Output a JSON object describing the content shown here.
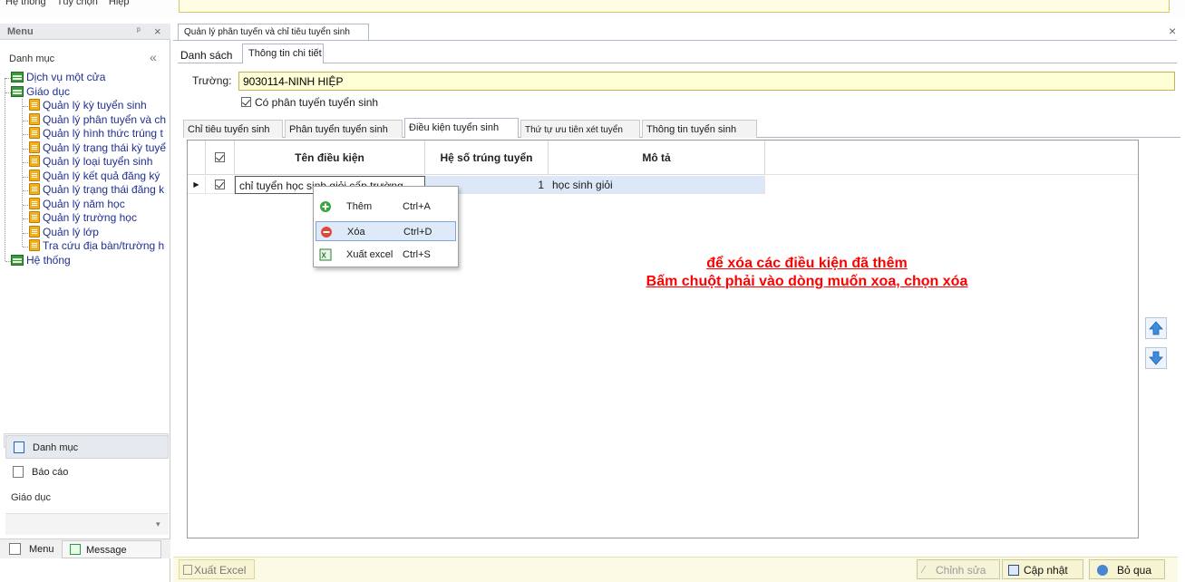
{
  "top_menu": [
    "Hệ thống",
    "Tùy chọn",
    "Hiệp"
  ],
  "left_panel": {
    "title": "Menu",
    "pin_glyph": "ᵖ",
    "section_title": "Danh mục",
    "tree": [
      {
        "label": "Dịch vụ một cửa",
        "level": 0,
        "icon": "folder-icon"
      },
      {
        "label": "Giáo dục",
        "level": 0,
        "icon": "folder-icon"
      },
      {
        "label": "Quản lý kỳ tuyển sinh",
        "level": 1,
        "icon": "doc-icon"
      },
      {
        "label": "Quản lý phân tuyển và ch",
        "level": 1,
        "icon": "doc-icon"
      },
      {
        "label": "Quản lý hình thức trúng t",
        "level": 1,
        "icon": "doc-icon"
      },
      {
        "label": "Quản lý trạng thái kỳ tuyể",
        "level": 1,
        "icon": "doc-icon"
      },
      {
        "label": "Quản lý loại tuyển sinh",
        "level": 1,
        "icon": "doc-icon"
      },
      {
        "label": "Quản lý kết quả đăng ký",
        "level": 1,
        "icon": "doc-icon"
      },
      {
        "label": "Quản lý trạng thái đăng k",
        "level": 1,
        "icon": "doc-icon"
      },
      {
        "label": "Quản lý năm học",
        "level": 1,
        "icon": "doc-icon"
      },
      {
        "label": "Quản lý trường học",
        "level": 1,
        "icon": "doc-icon"
      },
      {
        "label": "Quản lý lớp",
        "level": 1,
        "icon": "doc-icon"
      },
      {
        "label": "Tra cứu địa bàn/trường h",
        "level": 1,
        "icon": "doc-icon"
      },
      {
        "label": "Hệ thống",
        "level": 0,
        "icon": "folder-icon"
      }
    ],
    "nav": [
      {
        "label": "Danh mục",
        "active": true
      },
      {
        "label": "Báo cáo",
        "active": false
      }
    ],
    "group_label": "Giáo dục",
    "bottom_tabs": [
      "Menu",
      "Message"
    ]
  },
  "document": {
    "tab_title": "Quản lý phân tuyến và chỉ tiêu tuyển sinh",
    "sub_tabs": [
      "Danh sách",
      "Thông tin chi tiết"
    ],
    "truong_label": "Trường:",
    "truong_value": "9030114-NINH HIỆP",
    "checkbox_label": "Có phân tuyến tuyển sinh",
    "checkbox_checked": true,
    "inner_tabs": [
      "Chỉ tiêu tuyển sinh",
      "Phân tuyển tuyển sinh",
      "Điều kiện tuyển sinh",
      "Thứ tự ưu tiên xét tuyển",
      "Thông tin tuyển sinh"
    ],
    "active_inner_tab": 2
  },
  "grid": {
    "columns": [
      "Tên điều kiện",
      "Hệ số trúng tuyển",
      "Mô tả"
    ],
    "rows": [
      {
        "name": "chỉ tuyển học sinh giỏi cấp trường",
        "heso": "1",
        "mota": "học sinh giỏi",
        "checked": true
      }
    ]
  },
  "context_menu": [
    {
      "label": "Thêm",
      "shortcut": "Ctrl+A",
      "icon": "add-icon",
      "highlighted": false
    },
    {
      "label": "Xóa",
      "shortcut": "Ctrl+D",
      "icon": "delete-icon",
      "highlighted": true
    },
    {
      "label": "Xuất excel",
      "shortcut": "Ctrl+S",
      "icon": "excel-icon",
      "highlighted": false
    }
  ],
  "annotation": {
    "line1": "để xóa các điều kiện đã thêm",
    "line2": "Bấm chuột phải vào dòng muốn xoa, chọn xóa",
    "color": "#ff0000"
  },
  "toolbar": {
    "export_label": "Xuất Excel",
    "edit_label": "Chỉnh sửa",
    "update_label": "Cập nhật",
    "cancel_label": "Bỏ qua"
  }
}
